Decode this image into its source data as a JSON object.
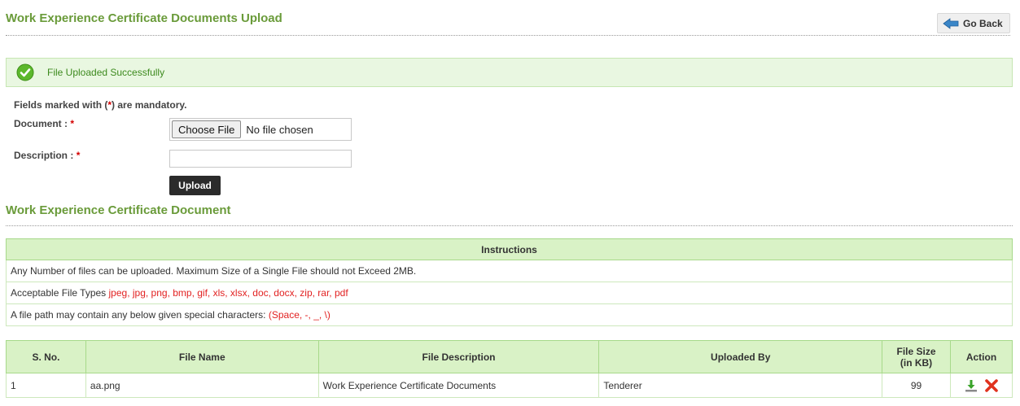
{
  "header": {
    "title": "Work Experience Certificate Documents Upload",
    "go_back_label": "Go Back"
  },
  "alert": {
    "message": "File Uploaded Successfully"
  },
  "form": {
    "mandatory_prefix": "Fields marked with (",
    "mandatory_star": "*",
    "mandatory_suffix": ") are mandatory.",
    "document_label": "Document :",
    "description_label": "Description :",
    "required_star": "*",
    "choose_file_label": "Choose File",
    "no_file_text": "No file chosen",
    "description_value": "",
    "upload_label": "Upload"
  },
  "section": {
    "title": "Work Experience Certificate Document"
  },
  "instructions": {
    "header": "Instructions",
    "line1": "Any Number of files can be uploaded. Maximum Size of a Single File should not Exceed 2MB.",
    "line2_prefix": "Acceptable File Types ",
    "line2_types": "jpeg, jpg, png, bmp, gif, xls, xlsx, doc, docx, zip, rar, pdf",
    "line3_prefix": "A file path may contain any below given special characters: ",
    "line3_chars": "(Space, -, _, \\)"
  },
  "files_table": {
    "columns": [
      "S. No.",
      "File Name",
      "File Description",
      "Uploaded By",
      "File Size",
      "(in KB)",
      "Action"
    ],
    "rows": [
      {
        "sno": "1",
        "file_name": "aa.png",
        "description": "Work Experience Certificate Documents",
        "uploaded_by": "Tenderer",
        "size": "99"
      }
    ]
  },
  "icons": {
    "back": "arrow-left-icon",
    "success": "check-circle-icon",
    "download": "download-icon",
    "delete": "delete-x-icon"
  },
  "colors": {
    "accent_green": "#6a9b3a",
    "header_bg": "#d9f2c6",
    "success_bg": "#e9f7e1",
    "required_red": "#e22222"
  }
}
